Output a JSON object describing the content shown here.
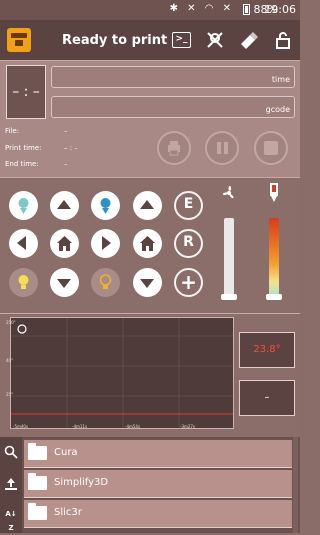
{
  "status_bar": {
    "battery_pct": "88%",
    "time": "19:06"
  },
  "toolbar": {
    "title": "Ready to print",
    "terminal_glyph": ">_",
    "icons": [
      "terminal-icon",
      "satellite-icon",
      "eraser-icon",
      "lock-icon"
    ]
  },
  "print_header": {
    "clock": "– : –",
    "time_label": "time",
    "gcode_label": "gcode",
    "file_label": "File:",
    "file_value": "–",
    "print_time_label": "Print time:",
    "print_time_value": "– : –",
    "end_time_label": "End time:",
    "end_time_value": "–"
  },
  "controls": {
    "extruder_label": "E",
    "reset_label": "R",
    "add_label": "+"
  },
  "graph": {
    "y_ticks": [
      "250°",
      "40°",
      "25°"
    ],
    "x_ticks": [
      "-5m40s",
      "-4m11s",
      "-4m54s",
      "-3m27s"
    ],
    "temp_reading": "23.8°",
    "second_reading": "–"
  },
  "files": {
    "items": [
      "Cura",
      "Simplify3D",
      "Slic3r"
    ]
  },
  "colors": {
    "bg": "#8a6c68",
    "toolbar": "#5b4341",
    "accent_logo": "#f2a018",
    "temp_red": "#ff4a3a",
    "row": "#b8918c"
  }
}
